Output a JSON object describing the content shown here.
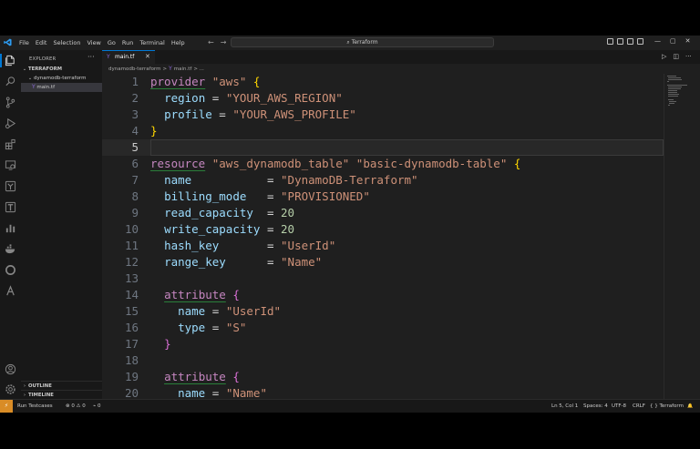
{
  "menu": [
    "File",
    "Edit",
    "Selection",
    "View",
    "Go",
    "Run",
    "Terminal",
    "Help"
  ],
  "nav": {
    "back": "←",
    "forward": "→"
  },
  "command_center": {
    "icon": "⌕",
    "label": "Terraform"
  },
  "window_controls": {
    "minimize": "—",
    "maximize": "▢",
    "close": "✕"
  },
  "sidebar": {
    "title": "EXPLORER",
    "more": "···",
    "section": "TERRAFORM",
    "folder": "dynamodb-terraform",
    "file": "main.tf",
    "outline": "OUTLINE",
    "timeline": "TIMELINE"
  },
  "tab": {
    "icon": "Y",
    "label": "main.tf",
    "close": "✕"
  },
  "editor_actions": {
    "run": "▷",
    "split": "◫",
    "more": "···"
  },
  "breadcrumb": {
    "folder": "dynamodb-terraform",
    "sep": ">",
    "file": "main.tf",
    "more": "> ..."
  },
  "code_lines": [
    {
      "n": "1"
    },
    {
      "n": "2"
    },
    {
      "n": "3"
    },
    {
      "n": "4"
    },
    {
      "n": "5"
    },
    {
      "n": "6"
    },
    {
      "n": "7"
    },
    {
      "n": "8"
    },
    {
      "n": "9"
    },
    {
      "n": "10"
    },
    {
      "n": "11"
    },
    {
      "n": "12"
    },
    {
      "n": "13"
    },
    {
      "n": "14"
    },
    {
      "n": "15"
    },
    {
      "n": "16"
    },
    {
      "n": "17"
    },
    {
      "n": "18"
    },
    {
      "n": "19"
    },
    {
      "n": "20"
    }
  ],
  "code": {
    "provider_kw": "provider",
    "provider_name": "\"aws\"",
    "region_key": "region",
    "region_val": "\"YOUR_AWS_REGION\"",
    "profile_key": "profile",
    "profile_val": "\"YOUR_AWS_PROFILE\"",
    "resource_kw": "resource",
    "resource_type": "\"aws_dynamodb_table\"",
    "resource_name": "\"basic-dynamodb-table\"",
    "name_key": "name",
    "name_val": "\"DynamoDB-Terraform\"",
    "billing_key": "billing_mode",
    "billing_val": "\"PROVISIONED\"",
    "read_key": "read_capacity",
    "read_val": "20",
    "write_key": "write_capacity",
    "write_val": "20",
    "hash_key": "hash_key",
    "hash_val": "\"UserId\"",
    "range_key": "range_key",
    "range_val": "\"Name\"",
    "attribute_kw": "attribute",
    "attr1_name_val": "\"UserId\"",
    "type_key": "type",
    "attr1_type_val": "\"S\"",
    "attr2_name_val": "\"Name\"",
    "eq": "=",
    "open": "{",
    "close": "}"
  },
  "status": {
    "remote": "⚡",
    "run_testcases": "Run Testcases",
    "problems": "⊗ 0 ⚠ 0",
    "ports": "⌁ 0",
    "position": "Ln 5, Col 1",
    "spaces": "Spaces: 4",
    "encoding": "UTF-8",
    "eol": "CRLF",
    "language": "Terraform",
    "bell": "🔔"
  },
  "colors": {
    "accent": "#0078d4",
    "keyword": "#c586c0",
    "string": "#ce9178",
    "number": "#b5cea8",
    "remote": "#d98c26"
  }
}
